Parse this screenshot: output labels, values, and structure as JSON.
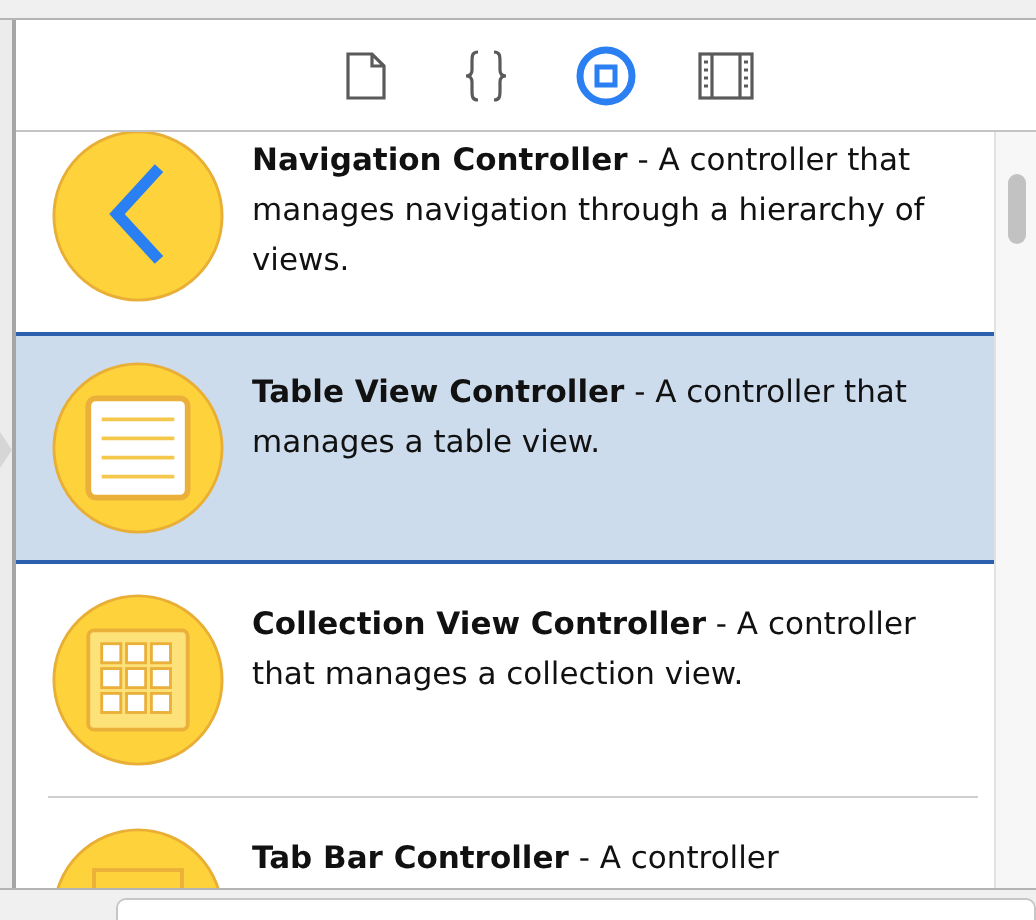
{
  "inspector_tabs": [
    {
      "kind": "file",
      "selected": false
    },
    {
      "kind": "braces",
      "selected": false
    },
    {
      "kind": "object",
      "selected": true
    },
    {
      "kind": "media",
      "selected": false
    }
  ],
  "library_items": [
    {
      "kind": "navigation",
      "title": "Navigation Controller",
      "description": "- A controller that manages navigation through a hierarchy of views.",
      "selected": false
    },
    {
      "kind": "table",
      "title": "Table View Controller",
      "description": "- A controller that manages a table view.",
      "selected": true
    },
    {
      "kind": "collection",
      "title": "Collection View Controller",
      "description": "- A controller that manages a collection view.",
      "selected": false
    },
    {
      "kind": "tabbar",
      "title": "Tab Bar Controller",
      "description": "- A controller",
      "selected": false
    }
  ]
}
